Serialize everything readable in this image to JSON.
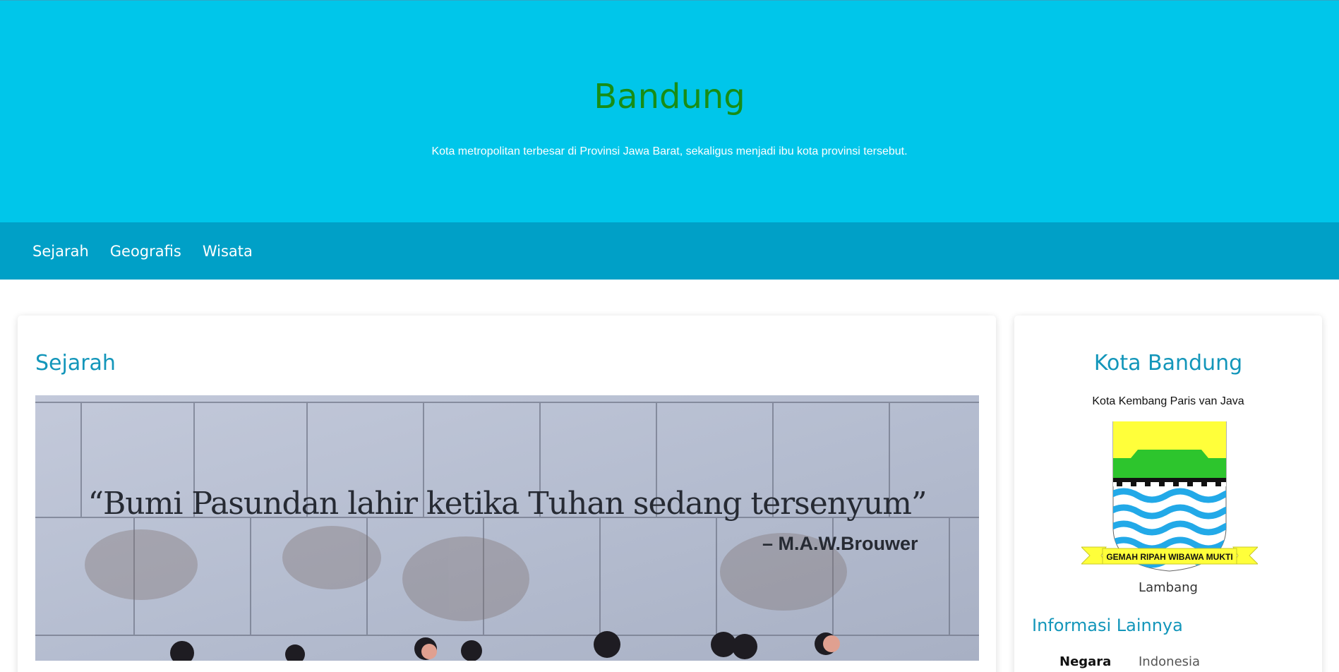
{
  "hero": {
    "title": "Bandung",
    "subtitle": "Kota metropolitan terbesar di Provinsi Jawa Barat, sekaligus menjadi ibu kota provinsi tersebut."
  },
  "nav": {
    "items": [
      {
        "label": "Sejarah"
      },
      {
        "label": "Geografis"
      },
      {
        "label": "Wisata"
      }
    ]
  },
  "main": {
    "section_title": "Sejarah",
    "image": {
      "quote": "“Bumi Pasundan lahir ketika Tuhan sedang tersenyum”",
      "author": "– M.A.W.Brouwer"
    }
  },
  "aside": {
    "title": "Kota Bandung",
    "subtitle": "Kota Kembang Paris van Java",
    "emblem": {
      "motto": "GEMAH RIPAH WIBAWA MUKTI",
      "caption": "Lambang"
    },
    "info_title": "Informasi Lainnya",
    "info": [
      {
        "key": "Negara",
        "value": "Indonesia"
      }
    ]
  },
  "colors": {
    "hero_bg": "#00c6ea",
    "nav_bg": "#00a0c7",
    "title_green": "#188d16",
    "heading_blue": "#1396ba"
  }
}
